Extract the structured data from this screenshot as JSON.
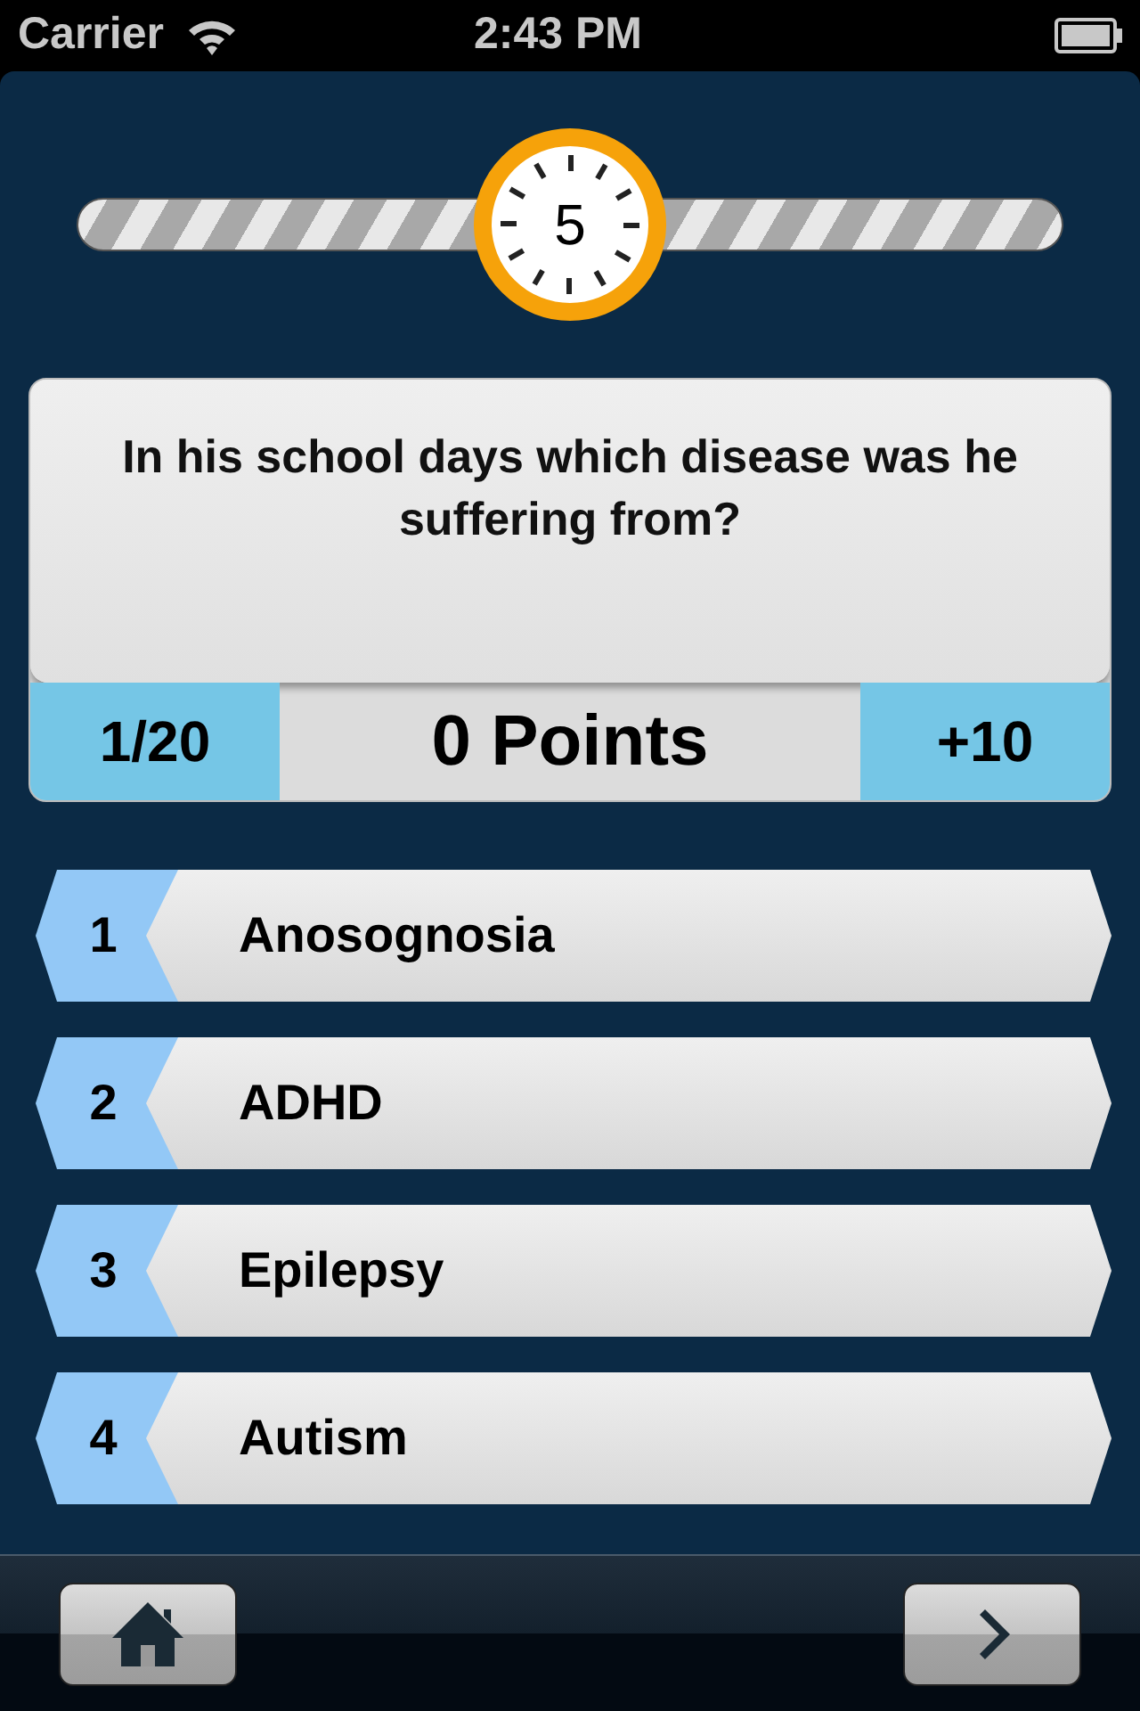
{
  "status_bar": {
    "carrier": "Carrier",
    "time": "2:43 PM"
  },
  "timer": {
    "seconds": "5"
  },
  "question": {
    "text": "In his school days which disease was he suffering from?",
    "progress": "1/20",
    "points": "0 Points",
    "bonus": "+10"
  },
  "answers": [
    {
      "number": "1",
      "label": "Anosognosia"
    },
    {
      "number": "2",
      "label": "ADHD"
    },
    {
      "number": "3",
      "label": "Epilepsy"
    },
    {
      "number": "4",
      "label": "Autism"
    }
  ]
}
